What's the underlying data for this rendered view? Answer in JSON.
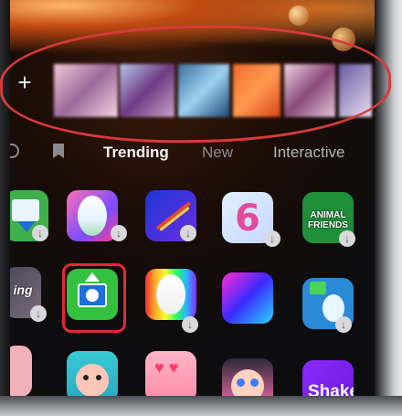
{
  "effects_bar": {
    "add_label": "+"
  },
  "tabs": [
    {
      "label": "Trending"
    },
    {
      "label": "New"
    },
    {
      "label": "Interactive"
    }
  ],
  "effects": {
    "animal_friends": "ANIMAL FRIENDS",
    "shake": "Shake",
    "partial_text": "ing"
  },
  "colors": {
    "annotation_red": "#d83a3a",
    "selected_border": "#e22a3a",
    "active_tab": "#f5f5f5",
    "inactive_tab": "#8d8d8f"
  }
}
